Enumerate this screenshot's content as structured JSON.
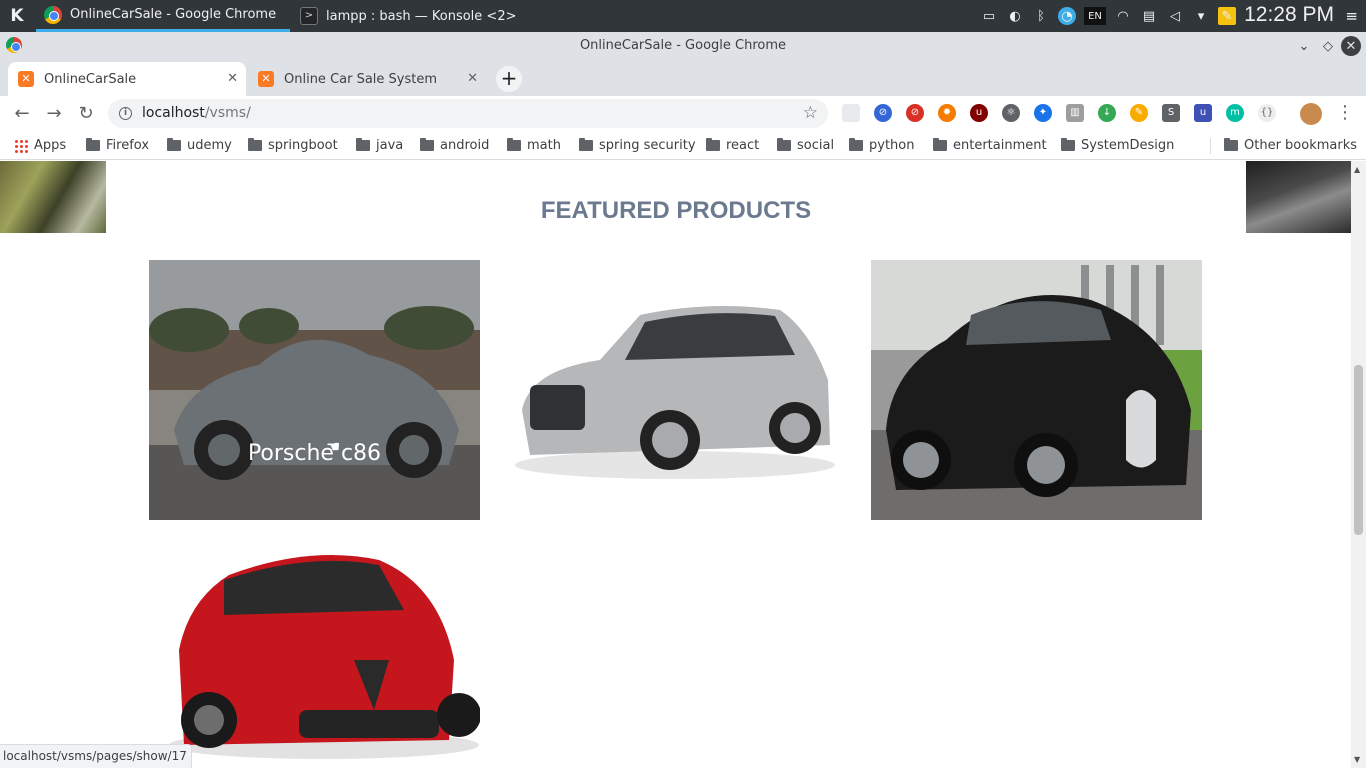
{
  "taskbar": {
    "tasks": [
      {
        "label": "OnlineCarSale - Google Chrome",
        "active": true
      },
      {
        "label": "lampp : bash — Konsole <2>",
        "active": false
      }
    ],
    "clock": "12:28 PM",
    "tray_icons": [
      "battery-icon",
      "tray-app-icon",
      "bluetooth-icon",
      "network-status-icon",
      "keyboard-layout-icon",
      "wifi-icon",
      "clipboard-icon",
      "volume-icon",
      "expand-arrow-icon",
      "notes-icon"
    ],
    "keyboard_layout": "EN"
  },
  "window": {
    "title": "OnlineCarSale - Google Chrome"
  },
  "tabs": [
    {
      "label": "OnlineCarSale",
      "active": true
    },
    {
      "label": "Online Car Sale System",
      "active": false
    }
  ],
  "toolbar": {
    "url_host": "localhost",
    "url_path": "/vsms/"
  },
  "bookmarks": {
    "items": [
      "Apps",
      "Firefox",
      "udemy",
      "springboot",
      "java",
      "android",
      "math",
      "spring security",
      "react",
      "social",
      "python",
      "entertainment",
      "SystemDesign"
    ],
    "other": "Other bookmarks"
  },
  "page": {
    "featured_title": "FEATURED PRODUCTS",
    "products": [
      {
        "name": "Porsche c86",
        "hovered": true,
        "image": "silver-porsche-550-spyder",
        "color": "#9aa3aa"
      },
      {
        "name": "",
        "hovered": false,
        "image": "silver-audi-allroad",
        "color": "#b5b7b9"
      },
      {
        "name": "",
        "hovered": false,
        "image": "black-bugatti-veyron",
        "color": "#1b1b1b"
      },
      {
        "name": "",
        "hovered": false,
        "image": "red-alfa-romeo-giulia",
        "color": "#c4161c"
      }
    ]
  },
  "status_bar": "localhost/vsms/pages/show/17"
}
